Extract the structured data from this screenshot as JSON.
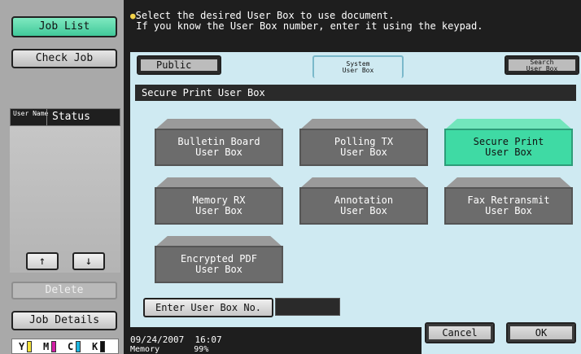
{
  "left": {
    "job_list": "Job List",
    "check_job": "Check Job",
    "header": {
      "user_name": "User Name",
      "status": "Status"
    },
    "up": "↑",
    "down": "↓",
    "delete": "Delete",
    "job_details": "Job Details",
    "toner": [
      "Y",
      "M",
      "C",
      "K"
    ],
    "toner_colors": [
      "#f4e23a",
      "#d21fa6",
      "#1fb6e0",
      "#111111"
    ]
  },
  "message": {
    "line1": "Select the desired User Box to use document.",
    "line2": " If you know the User Box number, enter it using the keypad."
  },
  "tabs": {
    "public": "Public",
    "system_1": "System",
    "system_2": "User Box",
    "search_1": "Search",
    "search_2": "User Box"
  },
  "panel_title": "Secure Print User Box",
  "boxes": [
    {
      "line1": "Bulletin Board",
      "line2": "User Box"
    },
    {
      "line1": "Polling TX",
      "line2": "User Box"
    },
    {
      "line1": "Secure Print",
      "line2": "User Box"
    },
    {
      "line1": "Memory RX",
      "line2": "User Box"
    },
    {
      "line1": "Annotation",
      "line2": "User Box"
    },
    {
      "line1": "Fax Retransmit",
      "line2": "User Box"
    },
    {
      "line1": "Encrypted PDF",
      "line2": "User Box"
    }
  ],
  "enter_box_label": "Enter User Box No.",
  "footer": {
    "date": "09/24/2007",
    "time": "16:07",
    "memory_label": "Memory",
    "memory_value": "99%",
    "cancel": "Cancel",
    "ok": "OK"
  },
  "colors": {
    "selected": "#3fdaa4",
    "panel": "#cfeaf2"
  }
}
